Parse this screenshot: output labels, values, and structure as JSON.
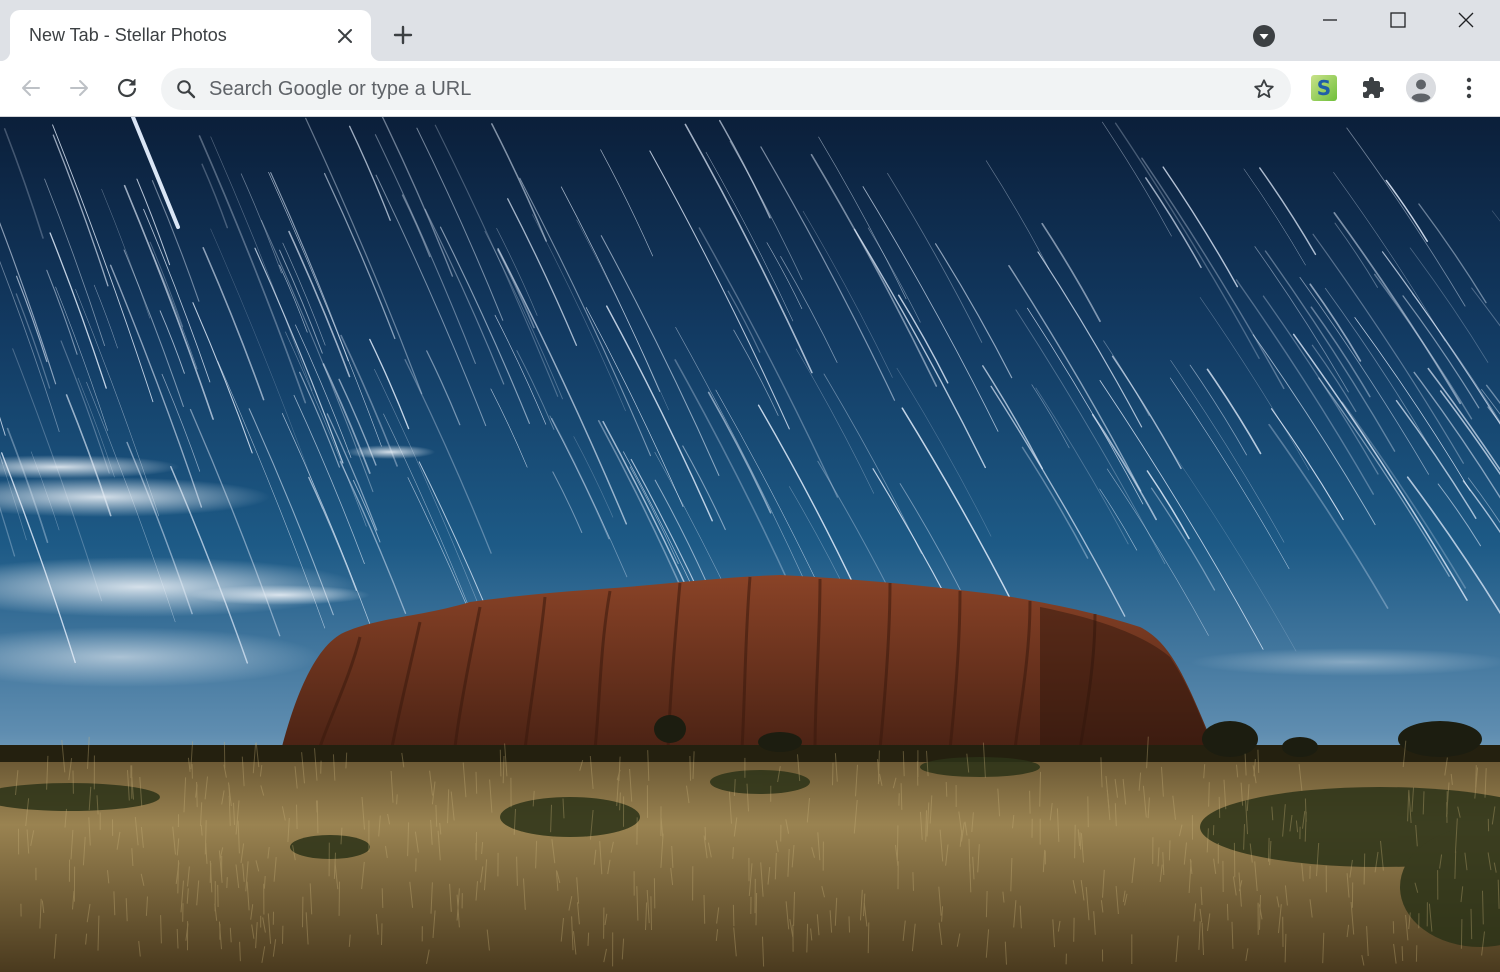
{
  "browser": {
    "tab": {
      "title": "New Tab - Stellar Photos",
      "close_icon": "close-icon"
    },
    "new_tab_icon": "plus-icon",
    "tab_search_icon": "chevron-down-icon",
    "window_controls": [
      "minimize-icon",
      "maximize-icon",
      "close-icon"
    ]
  },
  "toolbar": {
    "back_icon": "arrow-left-icon",
    "forward_icon": "arrow-right-icon",
    "reload_icon": "reload-icon",
    "omnibox": {
      "placeholder": "Search Google or type a URL",
      "value": ""
    },
    "bookmark_icon": "star-icon",
    "extension_badge_letter": "S",
    "extensions_icon": "puzzle-icon",
    "profile_icon": "avatar-icon",
    "menu_icon": "more-vertical-icon"
  },
  "background": {
    "description_icon": "photo",
    "palette": {
      "sky_top": "#0b1f3a",
      "sky_mid": "#1d5a86",
      "sky_horizon": "#8fb3cc",
      "rock": "#7a3a22",
      "grass": "#8a7340"
    }
  }
}
